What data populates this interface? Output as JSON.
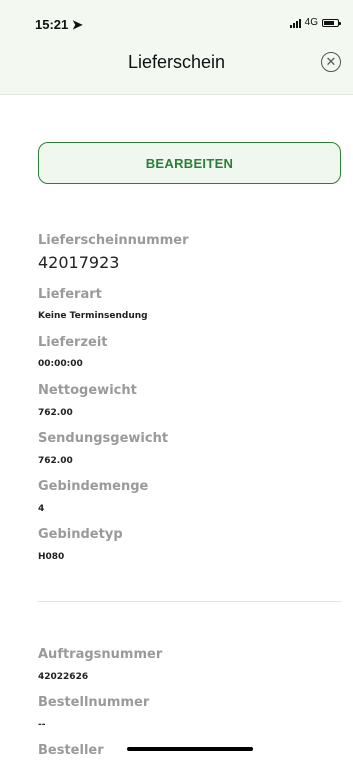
{
  "status_bar": {
    "time": "15:21",
    "network": "4G"
  },
  "header": {
    "title": "Lieferschein"
  },
  "actions": {
    "edit_label": "BEARBEITEN"
  },
  "fields": [
    {
      "label": "Lieferscheinnummer",
      "value": "42017923"
    },
    {
      "label": "Lieferart",
      "value": "Keine Terminsendung"
    },
    {
      "label": "Lieferzeit",
      "value": "00:00:00"
    },
    {
      "label": "Nettogewicht",
      "value": "762.00"
    },
    {
      "label": "Sendungsgewicht",
      "value": "762.00"
    },
    {
      "label": "Gebindemenge",
      "value": "4"
    },
    {
      "label": "Gebindetyp",
      "value": "H080"
    }
  ],
  "order_fields": [
    {
      "label": "Auftragsnummer",
      "value": "42022626"
    },
    {
      "label": "Bestellnummer",
      "value": "--"
    },
    {
      "label": "Besteller",
      "value": ""
    }
  ]
}
